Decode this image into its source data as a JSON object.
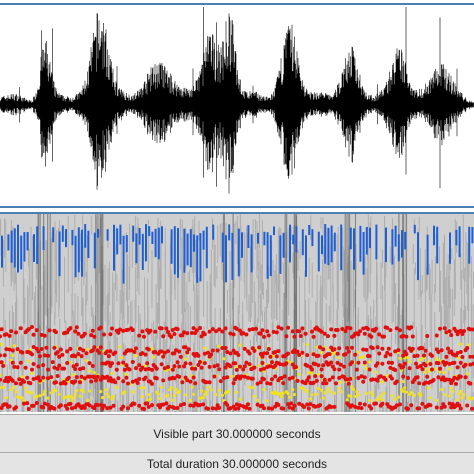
{
  "bars": {
    "visible_part": "Visible part 30.000000 seconds",
    "total_duration": "Total duration 30.000000 seconds"
  },
  "colors": {
    "panel_border": "#4a7fb6",
    "waveform": "#000000",
    "spectrogram_background": "#cfcfcf",
    "pitch": "#1f5fd6",
    "formant": "#e01010",
    "intensity": "#f2e21a"
  }
}
